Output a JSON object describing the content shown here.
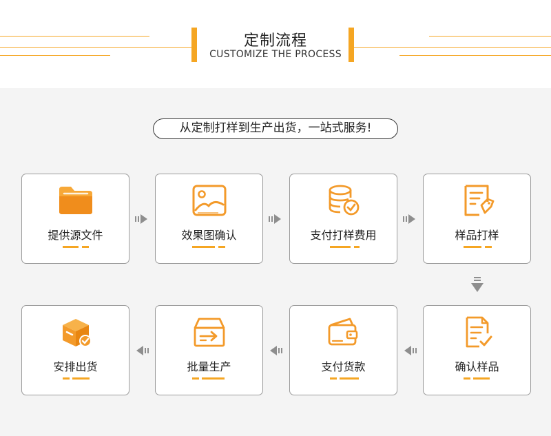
{
  "header": {
    "title_cn": "定制流程",
    "title_en": "CUSTOMIZE THE PROCESS"
  },
  "slogan": "从定制打样到生产出货，一站式服务!",
  "colors": {
    "accent": "#f5a623",
    "border": "#9a9a9a",
    "panel": "#f4f4f4"
  },
  "steps": [
    {
      "label": "提供源文件",
      "icon": "folder-icon"
    },
    {
      "label": "效果图确认",
      "icon": "image-icon"
    },
    {
      "label": "支付打样费用",
      "icon": "coins-check-icon"
    },
    {
      "label": "样品打样",
      "icon": "tagged-document-icon"
    },
    {
      "label": "确认样品",
      "icon": "checked-document-icon"
    },
    {
      "label": "支付货款",
      "icon": "wallet-icon"
    },
    {
      "label": "批量生产",
      "icon": "box-arrow-icon"
    },
    {
      "label": "安排出货",
      "icon": "package-check-icon"
    }
  ]
}
